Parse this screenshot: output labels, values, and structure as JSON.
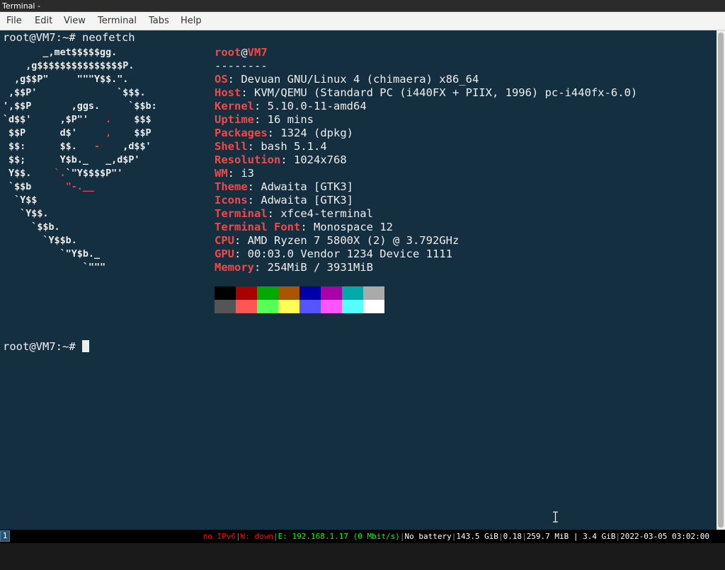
{
  "window": {
    "title": "Terminal -"
  },
  "menu": [
    "File",
    "Edit",
    "View",
    "Terminal",
    "Tabs",
    "Help"
  ],
  "terminal": {
    "prompt1": "root@VM7:~# neofetch",
    "prompt2": "root@VM7:~# ",
    "ascii_art": [
      [
        [
          "       _,met$$$$$gg.",
          ""
        ]
      ],
      [
        [
          "    ,g$$$$$$$$$$$$$$$P.",
          ""
        ]
      ],
      [
        [
          "  ,g$$P\"     \"\"\"Y$$.\".",
          ""
        ]
      ],
      [
        [
          " ,$$P'              `$$$.",
          ""
        ]
      ],
      [
        [
          "',$$P       ,ggs.     `$$b:",
          ""
        ]
      ],
      [
        [
          "`d$$'     ,$P\"'   ",
          ""
        ],
        [
          ".",
          "r"
        ],
        [
          "    $$$",
          ""
        ]
      ],
      [
        [
          " $$P      d$'     ",
          ""
        ],
        [
          ",",
          "r"
        ],
        [
          "    $$P",
          ""
        ]
      ],
      [
        [
          " $$:      $$.   ",
          ""
        ],
        [
          "-",
          "r"
        ],
        [
          "    ,d$$'",
          ""
        ]
      ],
      [
        [
          " $$;      Y$b._   _,d$P'",
          ""
        ]
      ],
      [
        [
          " Y$$.    ",
          ""
        ],
        [
          "`.",
          "r"
        ],
        [
          "`\"Y$$$$P\"'",
          ""
        ]
      ],
      [
        [
          " `$$b      ",
          ""
        ],
        [
          "\"-.__",
          "r"
        ]
      ],
      [
        [
          "  `Y$$",
          ""
        ]
      ],
      [
        [
          "   `Y$$.",
          ""
        ]
      ],
      [
        [
          "     `$$b.",
          ""
        ]
      ],
      [
        [
          "       `Y$$b.",
          ""
        ]
      ],
      [
        [
          "          `\"Y$b._",
          ""
        ]
      ],
      [
        [
          "              `\"\"\"",
          ""
        ]
      ]
    ],
    "user": "root",
    "at": "@",
    "host": "VM7",
    "separator": "--------",
    "info": [
      {
        "key": "OS",
        "value": "Devuan GNU/Linux 4 (chimaera) x86_64"
      },
      {
        "key": "Host",
        "value": "KVM/QEMU (Standard PC (i440FX + PIIX, 1996) pc-i440fx-6.0)"
      },
      {
        "key": "Kernel",
        "value": "5.10.0-11-amd64"
      },
      {
        "key": "Uptime",
        "value": "16 mins"
      },
      {
        "key": "Packages",
        "value": "1324 (dpkg)"
      },
      {
        "key": "Shell",
        "value": "bash 5.1.4"
      },
      {
        "key": "Resolution",
        "value": "1024x768"
      },
      {
        "key": "WM",
        "value": "i3"
      },
      {
        "key": "Theme",
        "value": "Adwaita [GTK3]"
      },
      {
        "key": "Icons",
        "value": "Adwaita [GTK3]"
      },
      {
        "key": "Terminal",
        "value": "xfce4-terminal"
      },
      {
        "key": "Terminal Font",
        "value": "Monospace 12"
      },
      {
        "key": "CPU",
        "value": "AMD Ryzen 7 5800X (2) @ 3.792GHz"
      },
      {
        "key": "GPU",
        "value": "00:03.0 Vendor 1234 Device 1111"
      },
      {
        "key": "Memory",
        "value": "254MiB / 3931MiB"
      }
    ],
    "palette_top": [
      "#000000",
      "#aa0000",
      "#00aa00",
      "#aa5500",
      "#0000aa",
      "#aa00aa",
      "#00aaaa",
      "#aaaaaa"
    ],
    "palette_bottom": [
      "#555555",
      "#ff5555",
      "#55ff55",
      "#ffff55",
      "#5555ff",
      "#ff55ff",
      "#55ffff",
      "#ffffff"
    ]
  },
  "statusbar": {
    "workspace": "1",
    "segments": [
      {
        "text": "no IPv6",
        "color": "#ff0000"
      },
      {
        "text": "W: down",
        "color": "#ff0000"
      },
      {
        "text": "E: 192.168.1.17 (0 Mbit/s)",
        "color": "#00ff00"
      },
      {
        "text": "No battery",
        "color": "#ffffff"
      },
      {
        "text": "143.5 GiB",
        "color": "#ffffff"
      },
      {
        "text": "0.18",
        "color": "#ffffff"
      },
      {
        "text": "259.7 MiB | 3.4 GiB",
        "color": "#ffffff"
      },
      {
        "text": "2022-03-05 03:02:00",
        "color": "#ffffff"
      }
    ]
  }
}
